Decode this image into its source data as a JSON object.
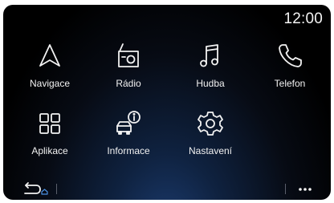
{
  "status_bar": {
    "time": "12:00"
  },
  "apps": [
    {
      "name": "navigation",
      "label": "Navigace",
      "icon": "navigation-arrow-icon"
    },
    {
      "name": "radio",
      "label": "Rádio",
      "icon": "radio-icon"
    },
    {
      "name": "music",
      "label": "Hudba",
      "icon": "music-note-icon"
    },
    {
      "name": "phone",
      "label": "Telefon",
      "icon": "phone-icon"
    },
    {
      "name": "apps",
      "label": "Aplikace",
      "icon": "apps-grid-icon"
    },
    {
      "name": "info",
      "label": "Informace",
      "icon": "car-info-icon"
    },
    {
      "name": "settings",
      "label": "Nastavení",
      "icon": "gear-icon"
    }
  ],
  "bottom_bar": {
    "back_icon": "back-home-icon",
    "more_icon": "more-dots-icon"
  },
  "colors": {
    "background": "#000000",
    "glow": "#1c3c70",
    "text": "#f2f2f2",
    "accent": "#4a90e2"
  }
}
